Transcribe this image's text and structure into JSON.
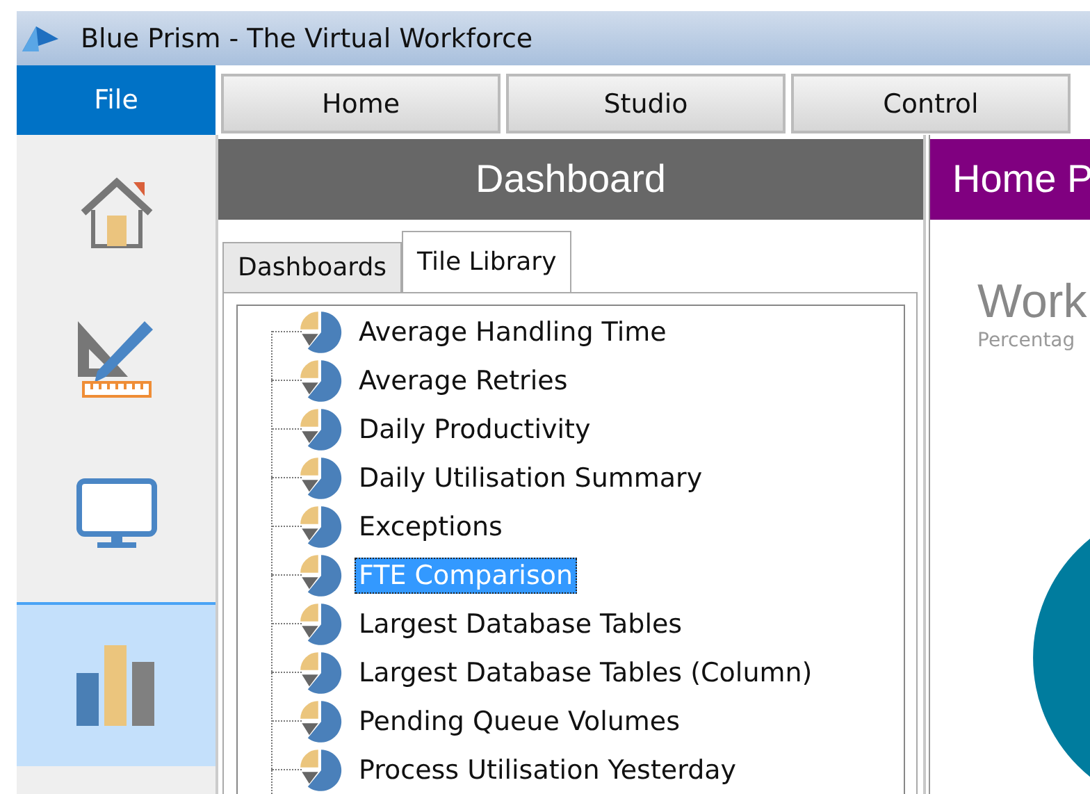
{
  "window": {
    "title": "Blue Prism - The Virtual Workforce"
  },
  "file_button": "File",
  "tabs": [
    {
      "label": "Home",
      "selected": false
    },
    {
      "label": "Studio",
      "selected": false
    },
    {
      "label": "Control",
      "selected": false
    }
  ],
  "sidebar": {
    "items": [
      {
        "kind": "home",
        "selected": false
      },
      {
        "kind": "studio",
        "selected": false
      },
      {
        "kind": "control",
        "selected": false
      },
      {
        "kind": "analytics",
        "selected": true
      }
    ]
  },
  "dashboard_panel": {
    "title": "Dashboard",
    "tabs": [
      {
        "label": "Dashboards",
        "selected": false
      },
      {
        "label": "Tile Library",
        "selected": true
      }
    ],
    "tree": [
      {
        "label": "Average Handling Time",
        "selected": false
      },
      {
        "label": "Average Retries",
        "selected": false
      },
      {
        "label": "Daily Productivity",
        "selected": false
      },
      {
        "label": "Daily Utilisation Summary",
        "selected": false
      },
      {
        "label": "Exceptions",
        "selected": false
      },
      {
        "label": "FTE Comparison",
        "selected": true
      },
      {
        "label": "Largest Database Tables",
        "selected": false
      },
      {
        "label": "Largest Database Tables (Column)",
        "selected": false
      },
      {
        "label": "Pending Queue Volumes",
        "selected": false
      },
      {
        "label": "Process Utilisation Yesterday",
        "selected": false
      }
    ]
  },
  "home_panel": {
    "title": "Home P",
    "tile_title": "Work",
    "tile_subtitle": "Percentag"
  }
}
